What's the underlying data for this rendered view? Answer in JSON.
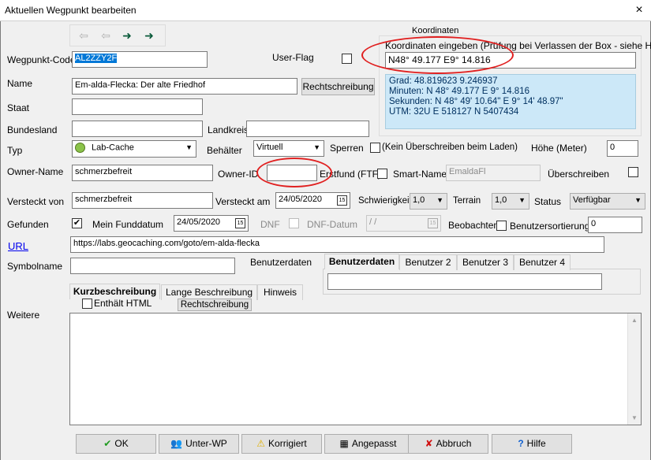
{
  "window": {
    "title": "Aktuellen Wegpunkt bearbeiten",
    "close": "×"
  },
  "nav": {
    "first": "⇦",
    "prev": "⇦",
    "next": "➜",
    "last": "➜"
  },
  "wegpunkt_code": {
    "label": "Wegpunkt-Code",
    "value": "AL2ZZY2F"
  },
  "user_flag": {
    "label": "User-Flag"
  },
  "name": {
    "label": "Name",
    "value": "Em-alda-Flecka: Der alte Friedhof",
    "spell_button": "Rechtschreibung"
  },
  "staat": {
    "label": "Staat",
    "value": ""
  },
  "bundesland": {
    "label": "Bundesland",
    "value": ""
  },
  "landkreis": {
    "label": "Landkreis",
    "value": ""
  },
  "typ": {
    "label": "Typ",
    "value": "Lab-Cache"
  },
  "behaelter": {
    "label": "Behälter",
    "value": "Virtuell"
  },
  "sperren": {
    "label": "Sperren",
    "note": "(Kein Überschreiben beim Laden)"
  },
  "hoehe": {
    "label": "Höhe (Meter)",
    "value": "0"
  },
  "owner_name": {
    "label": "Owner-Name",
    "value": "schmerzbefreit"
  },
  "owner_id": {
    "label": "Owner-ID",
    "value": ""
  },
  "erstfund": {
    "label": "Erstfund (FTF)"
  },
  "smart_name": {
    "label": "Smart-Name",
    "value": "EmaldaFl"
  },
  "ueberschreiben": {
    "label": "Überschreiben"
  },
  "versteckt_von": {
    "label": "Versteckt von",
    "value": "schmerzbefreit"
  },
  "versteckt_am": {
    "label": "Versteckt am",
    "value": "24/05/2020"
  },
  "schwierigkeit": {
    "label": "Schwierigkeit",
    "value": "1,0"
  },
  "terrain": {
    "label": "Terrain",
    "value": "1,0"
  },
  "status": {
    "label": "Status",
    "value": "Verfügbar"
  },
  "gefunden": {
    "label": "Gefunden",
    "mein_funddatum_label": "Mein Funddatum",
    "funddatum": "24/05/2020"
  },
  "dnf": {
    "label": "DNF",
    "datum_label": "DNF-Datum",
    "datum_value": " / /"
  },
  "beobachten": {
    "label": "Beobachten"
  },
  "benutzersortierung": {
    "label": "Benutzersortierung",
    "value": "0"
  },
  "url": {
    "label": "URL",
    "value": "https://labs.geocaching.com/goto/em-alda-flecka"
  },
  "symbolname": {
    "label": "Symbolname",
    "value": ""
  },
  "benutzerdaten": {
    "label": "Benutzerdaten",
    "tabs": [
      "Benutzerdaten",
      "Benutzer 2",
      "Benutzer 3",
      "Benutzer 4"
    ],
    "value": ""
  },
  "koordinaten": {
    "group_title": "Koordinaten",
    "input_label": "Koordinaten eingeben (Prüfung bei Verlassen der Box - siehe Hilfe)",
    "input_value": "N48° 49.177  E9° 14.816",
    "info_lines": [
      "Grad:  48.819623  9.246937",
      "Minuten:  N 48° 49.177  E 9° 14.816",
      "Sekunden:  N 48° 49' 10.64\"  E 9° 14' 48.97\"",
      "UTM:  32U  E 518127  N 5407434"
    ]
  },
  "description_tabs": [
    "Kurzbeschreibung",
    "Lange Beschreibung",
    "Hinweis"
  ],
  "enthaelt_html": {
    "label": "Enthält HTML",
    "spell_button": "Rechtschreibung"
  },
  "weitere": {
    "label": "Weitere"
  },
  "buttons": {
    "ok": {
      "label": "OK",
      "icon": "✔"
    },
    "unter_wp": {
      "label": "Unter-WP",
      "icon": "👥"
    },
    "korrigiert": {
      "label": "Korrigiert",
      "icon": "⚠"
    },
    "angepasst": {
      "label": "Angepasst",
      "icon": "▦"
    },
    "abbruch": {
      "label": "Abbruch",
      "icon": "✘"
    },
    "hilfe": {
      "label": "Hilfe",
      "icon": "?"
    }
  },
  "colors": {
    "coord_info_bg": "#cce8f8",
    "selection": "#0078d7",
    "highlight_circle": "#e02020"
  }
}
